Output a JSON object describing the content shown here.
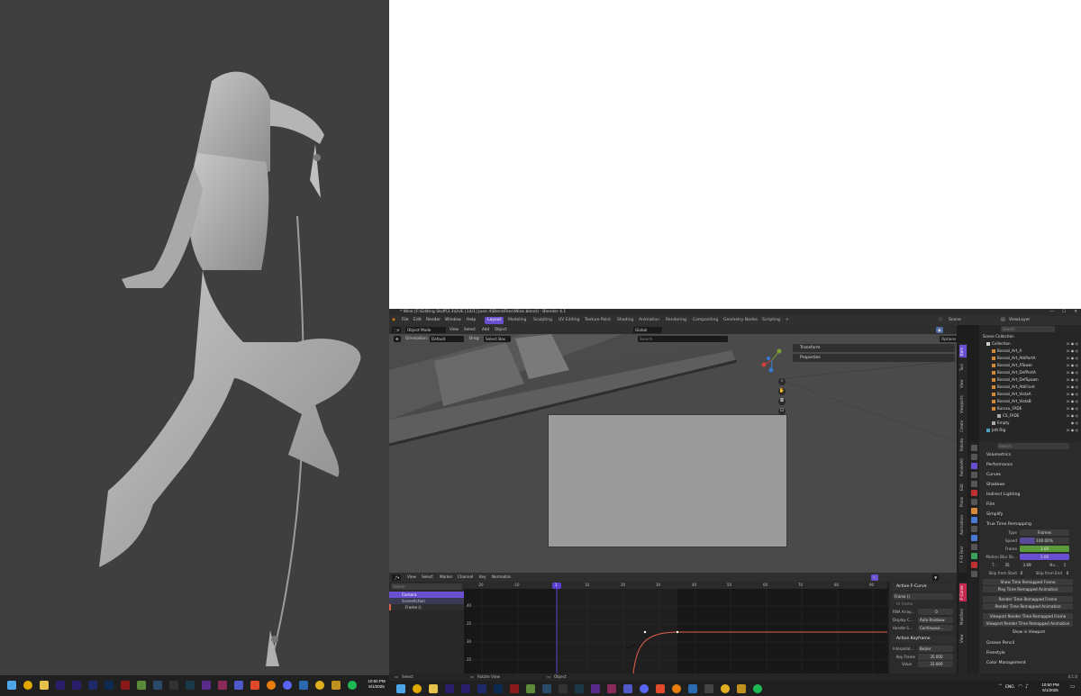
{
  "left_clock": {
    "time": "10:50 PM",
    "date": "6/1/2025"
  },
  "right_clock": {
    "time": "10:50 PM",
    "date": "6/1/2025",
    "lang": "ENG"
  },
  "blender": {
    "title": "* Wink [F:\\Editing Stuff\\3.3\\DUE [14/1] June 4\\BlendFiles\\Wink.blend] - Blender 4.1",
    "menu": [
      "File",
      "Edit",
      "Render",
      "Window",
      "Help"
    ],
    "workspaces": [
      "Layout",
      "Modeling",
      "Sculpting",
      "UV Editing",
      "Texture Paint",
      "Shading",
      "Animation",
      "Rendering",
      "Compositing",
      "Geometry Nodes",
      "Scripting"
    ],
    "add_tab": "+",
    "scene": "Scene",
    "view_layer": "ViewLayer",
    "viewport_header": {
      "mode": "Object Mode",
      "items": [
        "View",
        "Select",
        "Add",
        "Object"
      ],
      "transform": "Global",
      "orientation_label": "Orientation:",
      "orientation_value": "Default",
      "drag_label": "Drag:",
      "drag_value": "Select Box",
      "options": "Options",
      "search_placeholder": "Search"
    },
    "npanel": {
      "sections": [
        "Transform",
        "Properties"
      ],
      "tabs": [
        "Item",
        "Tool",
        "View",
        "Viewports",
        "Create",
        "Rokoko",
        "RenderAO",
        "Edit",
        "Plane",
        "Animations",
        "F-Fit Fear"
      ]
    },
    "graph_editor": {
      "header_items": [
        "View",
        "Select",
        "Marker",
        "Channel",
        "Key"
      ],
      "normalize": "Normalize",
      "search_placeholder": "Search",
      "channels": [
        "Camera",
        "SceneAction",
        "Frame ()"
      ],
      "x_ticks": [
        "-20",
        "-10",
        "1",
        "10",
        "20",
        "30",
        "40",
        "50",
        "60",
        "70",
        "80",
        "90"
      ],
      "current_frame": "1",
      "y_ticks": [
        "40",
        "35",
        "30",
        "25"
      ],
      "vtabs": [
        "F-Curve",
        "Modifiers",
        "View"
      ]
    },
    "fcurve_panel": {
      "title": "Active F-Curve",
      "channel": "Frame ()",
      "field": "tri Frame",
      "rna_label": "RNA Array...",
      "rna_value": "0",
      "display_label": "Display C...",
      "display_value": "Auto Rainbow",
      "handle_label": "Handle S...",
      "handle_value": "Continuous ...",
      "keyframe_title": "Active Keyframe",
      "interp_label": "Interpolat...",
      "interp_value": "Bezier",
      "keyframe_label": "Key Frame",
      "keyframe_value": "35.000",
      "value_label": "Value",
      "value_value": "33.000"
    },
    "outliner": {
      "search_placeholder": "Search",
      "rows": [
        "Scene Collection",
        "Collection",
        "Bonsai_Art_A",
        "Bonsai_Art_AtkPortA",
        "Bonsai_Art_ATower",
        "Bonsai_Art_DefPortA",
        "Bonsai_Art_DefSpawn",
        "Bonsai_Art_AtkFront",
        "Bonsai_Art_VistaA",
        "Bonsai_Art_VistaB",
        "Kurusu_FADE",
        "CS_FADE",
        "Empty",
        "Jett Rig"
      ]
    },
    "properties": {
      "search_placeholder": "Search",
      "panels": [
        "Volumetrics",
        "Performance",
        "Curves",
        "Shadows",
        "Indirect Lighting",
        "Film",
        "Simplify"
      ],
      "ttr_title": "True Time Remapping",
      "type_label": "Type",
      "type_value": "Frames",
      "speed_label": "Speed",
      "speed_value": "100.00%",
      "frame_label": "Frame",
      "frame_value": "3.69",
      "motion_blur_label": "Motion Blur Sh...",
      "motion_blur_value": "1.00",
      "t_label": "T...",
      "t_value": "35",
      "t_value2": "3.69",
      "n_label": "Nu...",
      "n_value": "1",
      "skip_start": "Skip from Start",
      "skip_start_value": "0",
      "skip_end": "Skip from End",
      "skip_end_value": "0",
      "buttons": [
        "Show Time Remapped Frame",
        "Play Time Remapped Animation",
        "Render Time Remapped Frame",
        "Render Time Remapped Animation",
        "Viewport Render Time Remapped Frame",
        "Viewport Render Time Remapped Animation"
      ],
      "show_in_viewport": "Show in Viewport",
      "bottom_panels": [
        "Grease Pencil",
        "Freestyle",
        "Color Management"
      ]
    },
    "status": {
      "select": "Select",
      "rotate": "Rotate View",
      "object": "Object",
      "version": "4.1.0"
    }
  },
  "colors": {
    "accent": "#6a4fd1",
    "frame_green": "#5b9a3a",
    "curve": "#e0604a",
    "playhead": "#5a3fcf"
  }
}
